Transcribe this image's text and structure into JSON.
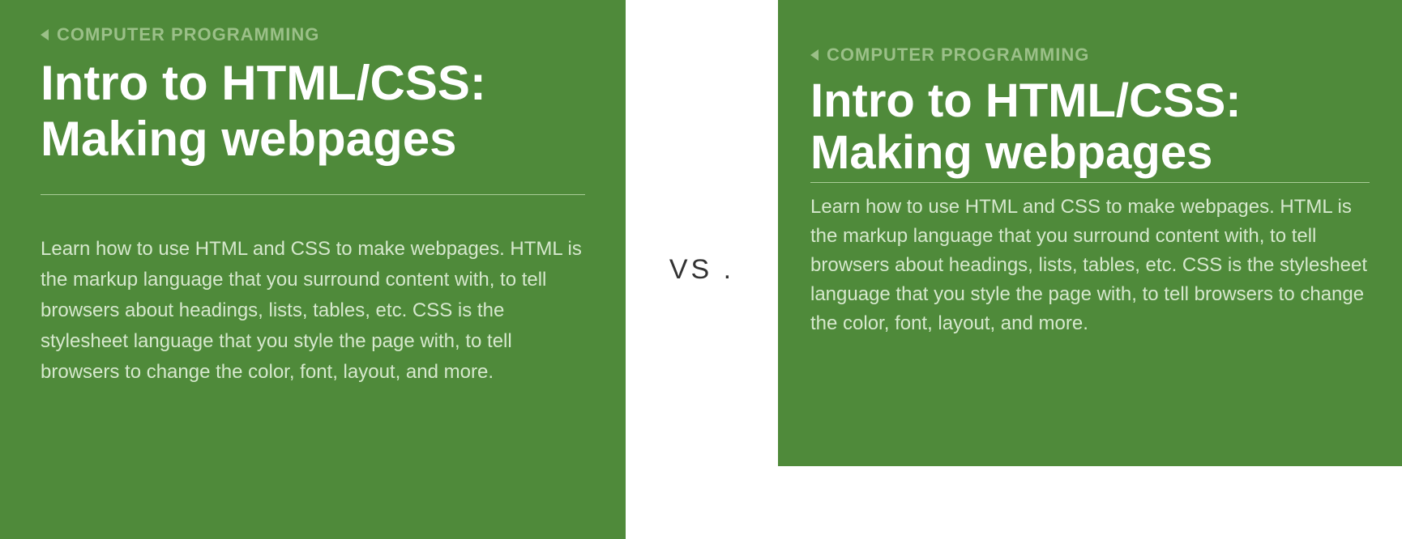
{
  "left": {
    "breadcrumb": "COMPUTER PROGRAMMING",
    "title_line1": "Intro to HTML/CSS:",
    "title_line2": "Making webpages",
    "description": "Learn how to use HTML and CSS to make webpages. HTML is the markup language that you surround content with, to tell browsers about headings, lists, tables, etc. CSS is the stylesheet language that you style the page with, to tell browsers to change the color, font, layout, and more."
  },
  "middle": {
    "label": "VS ."
  },
  "right": {
    "breadcrumb": "COMPUTER PROGRAMMING",
    "title_line1": "Intro to HTML/CSS:",
    "title_line2": "Making webpages",
    "description": "Learn how to use HTML and CSS to make webpages. HTML is the markup language that you surround content with, to tell browsers about headings, lists, tables, etc. CSS is the stylesheet language that you style the page with, to tell browsers to change the color, font, layout, and more."
  }
}
